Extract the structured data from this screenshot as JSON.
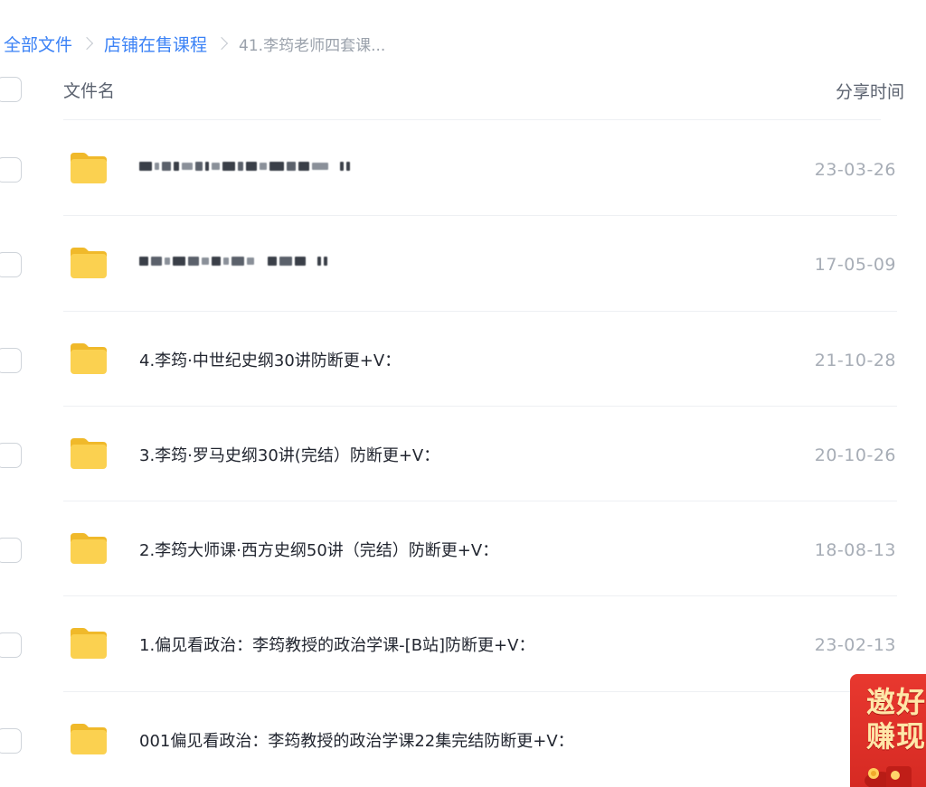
{
  "breadcrumb": {
    "items": [
      "全部文件",
      "店铺在售课程"
    ],
    "current": "41.李筠老师四套课..."
  },
  "list_header": {
    "name_label": "文件名",
    "time_label": "分享时间"
  },
  "files": [
    {
      "name": "",
      "time": "23-03-26",
      "blurred": true
    },
    {
      "name": "",
      "time": "17-05-09",
      "blurred": true
    },
    {
      "name": "4.李筠·中世纪史纲30讲防断更+V：",
      "time": "21-10-28",
      "blurred": false
    },
    {
      "name": "3.李筠·罗马史纲30讲(完结）防断更+V：",
      "time": "20-10-26",
      "blurred": false
    },
    {
      "name": "2.李筠大师课·西方史纲50讲（完结）防断更+V：",
      "time": "18-08-13",
      "blurred": false
    },
    {
      "name": "1.偏见看政治：李筠教授的政治学课-[B站]防断更+V：",
      "time": "23-02-13",
      "blurred": false
    },
    {
      "name": "001偏见看政治：李筠教授的政治学课22集完结防断更+V：",
      "time": "23-0",
      "blurred": false
    }
  ],
  "promo": {
    "line1": "邀好",
    "line2": "赚现"
  },
  "colors": {
    "link": "#3b82f6",
    "folder": "#fbd150",
    "promo_red": "#e8382f",
    "promo_text": "#ffe7a8"
  }
}
